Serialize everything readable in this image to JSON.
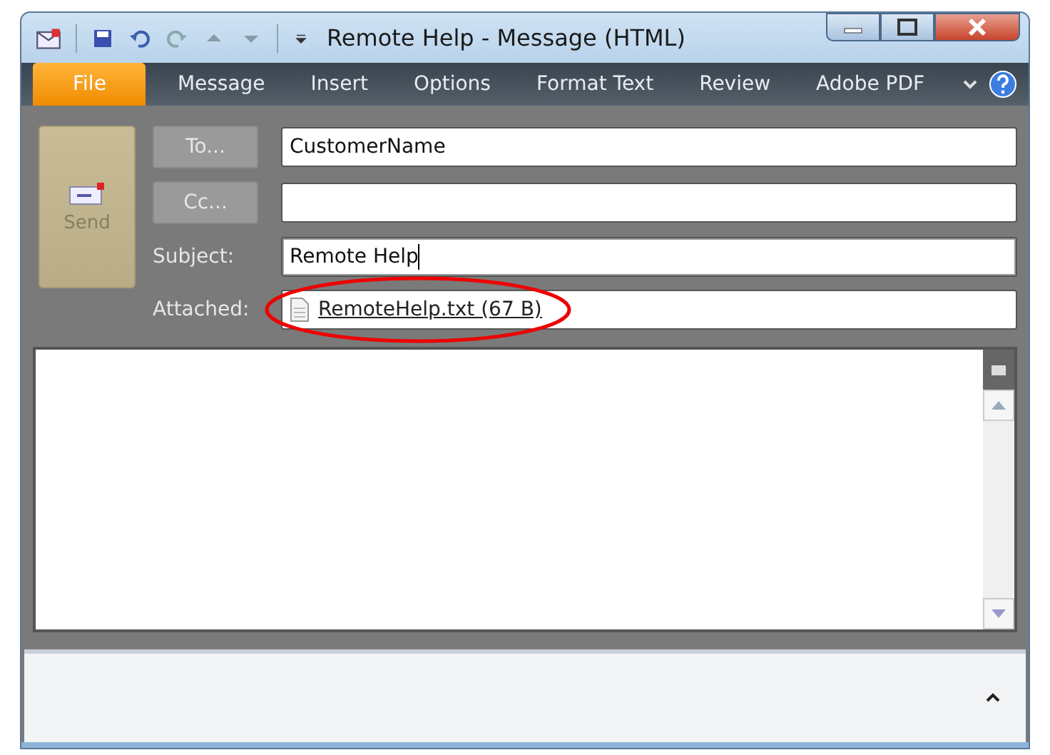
{
  "window": {
    "title": "Remote Help  -  Message (HTML)"
  },
  "tabs": [
    {
      "label": "File",
      "selected": true
    },
    {
      "label": "Message",
      "selected": false
    },
    {
      "label": "Insert",
      "selected": false
    },
    {
      "label": "Options",
      "selected": false
    },
    {
      "label": "Format Text",
      "selected": false
    },
    {
      "label": "Review",
      "selected": false
    },
    {
      "label": "Adobe PDF",
      "selected": false
    }
  ],
  "send_button": {
    "label": "Send",
    "disabled": true
  },
  "header_rows": [
    {
      "kind": "button",
      "label": "To...",
      "value": "CustomerName"
    },
    {
      "kind": "button",
      "label": "Cc..."
    },
    {
      "kind": "label",
      "label": "Subject:",
      "value": "Remote Help",
      "focused": true
    },
    {
      "kind": "attachment",
      "label": "Attached:",
      "value": "RemoteHelp.txt (67 B)",
      "highlighted": true
    }
  ]
}
